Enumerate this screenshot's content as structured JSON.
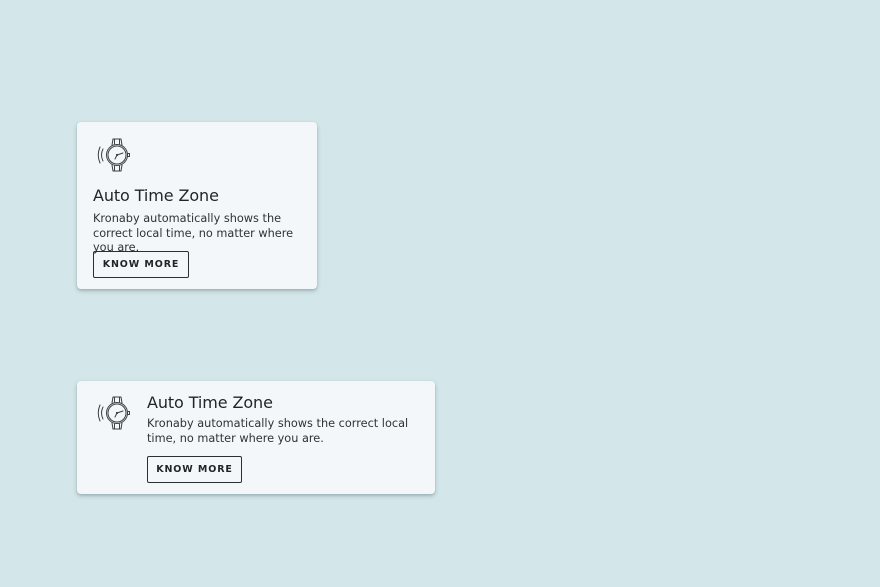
{
  "cards": [
    {
      "layout": "vertical",
      "icon": "watch-icon",
      "title": "Auto Time Zone",
      "description": "Kronaby automatically shows the correct local time, no matter where you are.",
      "button_label": "KNOW MORE"
    },
    {
      "layout": "horizontal",
      "icon": "watch-icon",
      "title": "Auto Time Zone",
      "description": "Kronaby automatically shows the correct local time, no matter where you are.",
      "button_label": "KNOW MORE"
    }
  ],
  "colors": {
    "background": "#d3e7ea",
    "card": "#f3f7f9",
    "text": "#1f2426"
  }
}
